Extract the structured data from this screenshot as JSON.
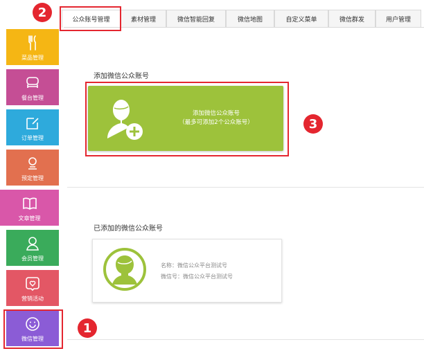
{
  "sidebar": {
    "items": [
      {
        "label": "菜品管理",
        "icon": "utensils-icon",
        "color": "#f5b614"
      },
      {
        "label": "餐台管理",
        "icon": "dining-table-icon",
        "color": "#c54e95"
      },
      {
        "label": "订单管理",
        "icon": "order-edit-icon",
        "color": "#2eaadc"
      },
      {
        "label": "预定管理",
        "icon": "reservation-icon",
        "color": "#e2704f"
      },
      {
        "label": "文章管理",
        "icon": "book-icon",
        "color": "#d957a9"
      },
      {
        "label": "会员管理",
        "icon": "member-icon",
        "color": "#3aab5b"
      },
      {
        "label": "营销活动",
        "icon": "heart-chat-icon",
        "color": "#e35765"
      },
      {
        "label": "微信管理",
        "icon": "smile-icon",
        "color": "#8b5cd6"
      }
    ]
  },
  "tabs": [
    "公众账号管理",
    "素材管理",
    "微信智能回复",
    "微信地图",
    "自定义菜单",
    "微信群发",
    "用户管理"
  ],
  "annotations": [
    "1",
    "2",
    "3"
  ],
  "add_section": {
    "title": "添加微信公众账号",
    "button_line1": "添加微信公众账号",
    "button_line2": "（最多可添加2个公众账号）"
  },
  "added_section": {
    "title": "已添加的微信公众账号",
    "name_line": "名称：微信公众平台测试号",
    "wechat_line": "微信号：微信公众平台测试号"
  },
  "colors": {
    "accent_green": "#9dc23b",
    "annotation_red": "#e4262f"
  }
}
